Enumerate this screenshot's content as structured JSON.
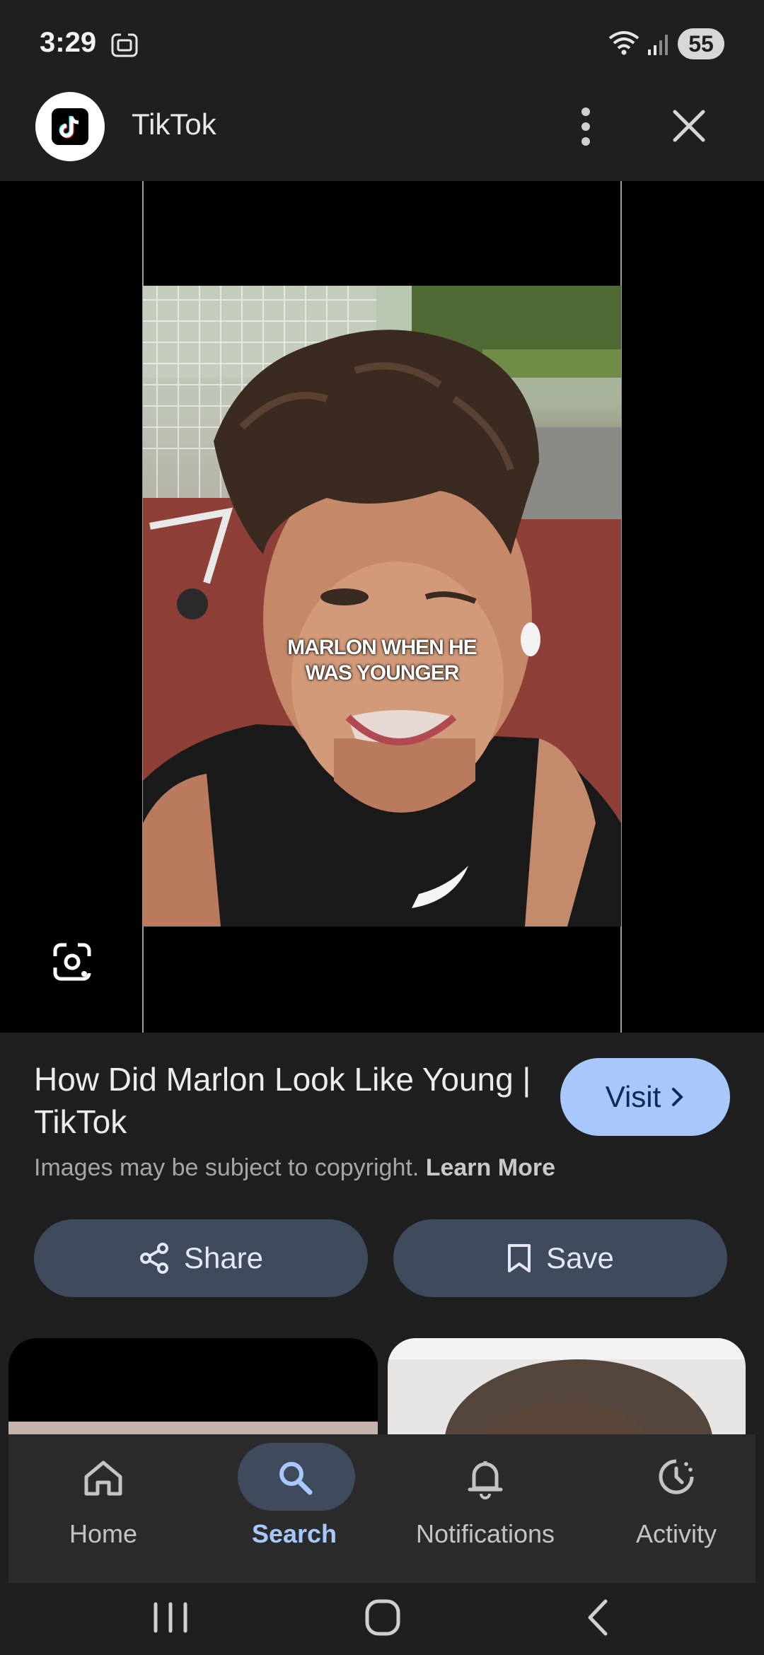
{
  "status_bar": {
    "time": "3:29",
    "battery": "55"
  },
  "app_bar": {
    "site_name": "TikTok"
  },
  "image": {
    "caption_line1": "MARLON WHEN HE",
    "caption_line2": "WAS YOUNGER"
  },
  "result": {
    "title": "How Did Marlon Look Like Young | TikTok",
    "visit_label": "Visit",
    "copyright_text": "Images may be subject to copyright.",
    "learn_more": "Learn More"
  },
  "actions": {
    "share_label": "Share",
    "save_label": "Save"
  },
  "bottom_nav": {
    "items": [
      {
        "label": "Home",
        "icon": "home-icon"
      },
      {
        "label": "Search",
        "icon": "search-icon",
        "active": true
      },
      {
        "label": "Notifications",
        "icon": "bell-icon"
      },
      {
        "label": "Activity",
        "icon": "activity-icon"
      }
    ]
  },
  "colors": {
    "background": "#1f1f1f",
    "accent": "#a8c7fa",
    "pill": "#3f4a5d"
  }
}
